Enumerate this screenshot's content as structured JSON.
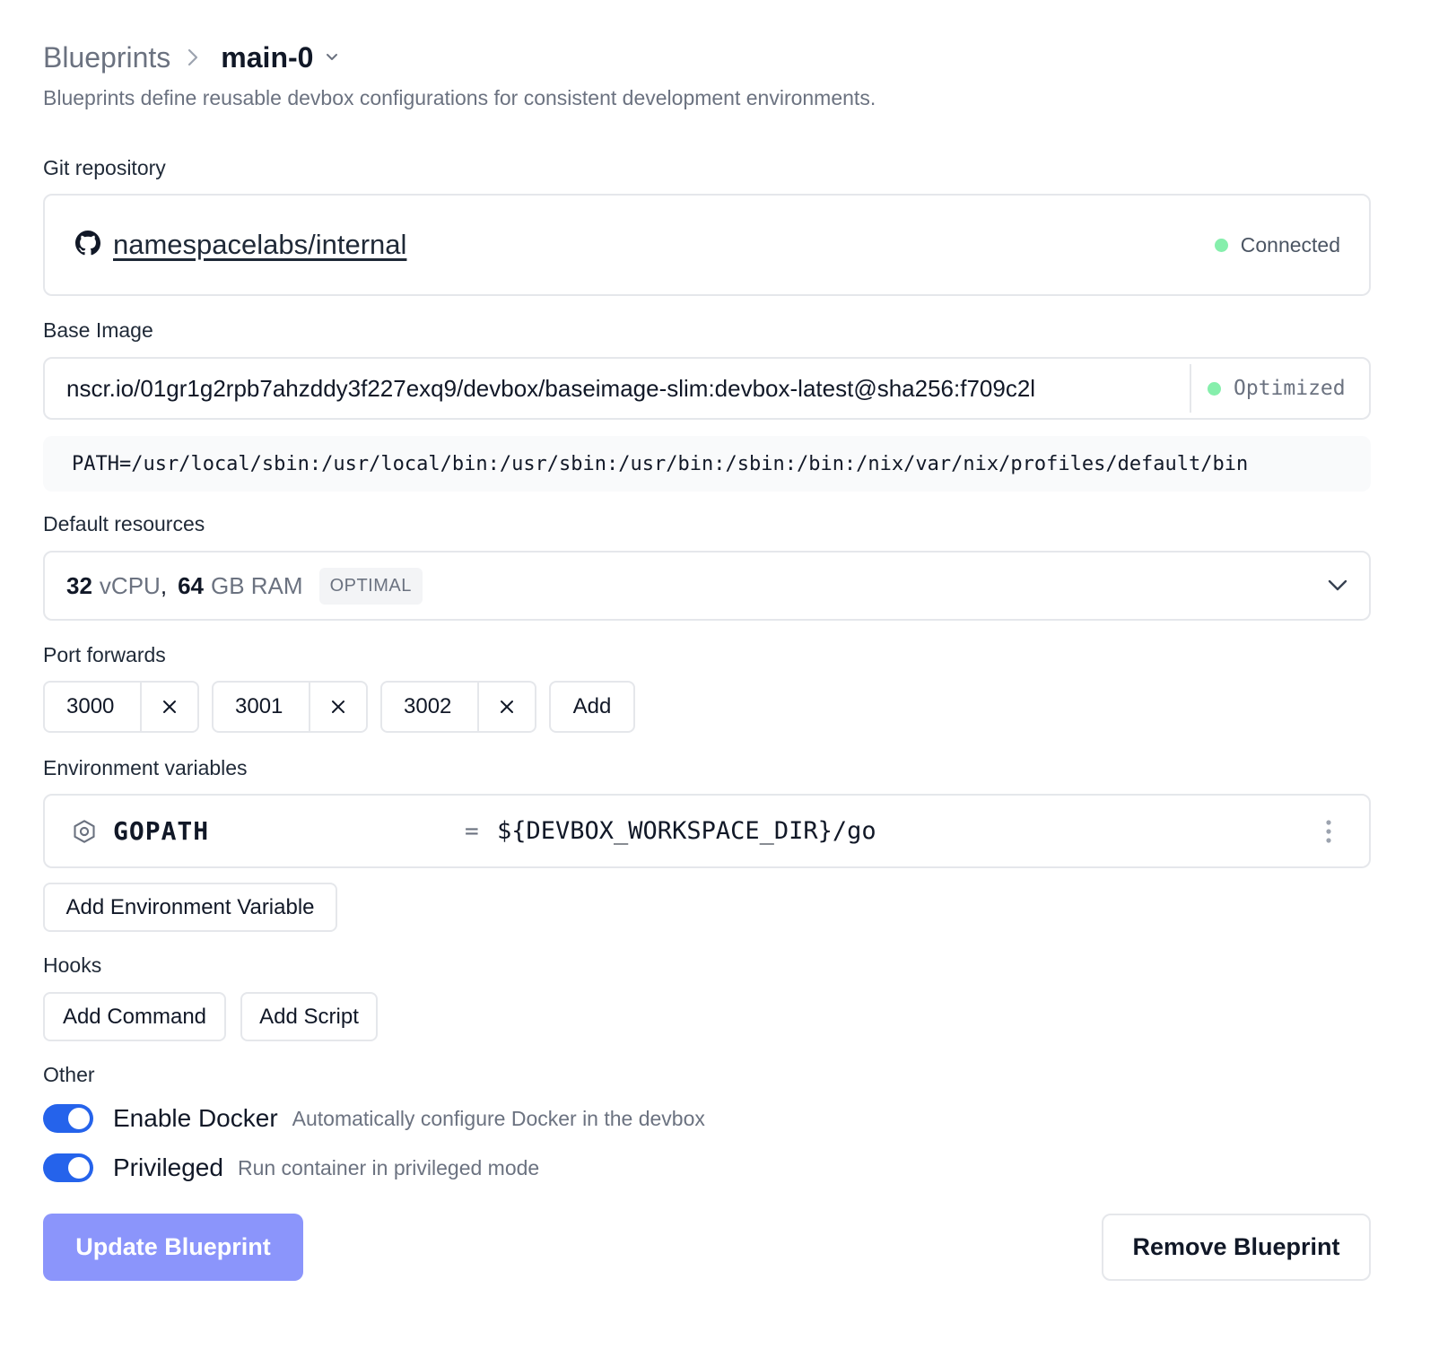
{
  "breadcrumb": {
    "parent": "Blueprints",
    "current": "main-0"
  },
  "description": "Blueprints define reusable devbox configurations for consistent development environments.",
  "git": {
    "label": "Git repository",
    "repo": "namespacelabs/internal",
    "status": "Connected",
    "status_color": "#86efac"
  },
  "base_image": {
    "label": "Base Image",
    "value": "nscr.io/01gr1g2rpb7ahzddy3f227exq9/devbox/baseimage-slim:devbox-latest@sha256:f709c2l",
    "badge": "Optimized",
    "path": "PATH=/usr/local/sbin:/usr/local/bin:/usr/sbin:/usr/bin:/sbin:/bin:/nix/var/nix/profiles/default/bin"
  },
  "resources": {
    "label": "Default resources",
    "cpu_value": "32",
    "cpu_unit": "vCPU",
    "ram_value": "64",
    "ram_unit": "GB RAM",
    "tag": "OPTIMAL"
  },
  "ports": {
    "label": "Port forwards",
    "items": [
      "3000",
      "3001",
      "3002"
    ],
    "add_label": "Add"
  },
  "env": {
    "label": "Environment variables",
    "items": [
      {
        "name": "GOPATH",
        "eq": "=",
        "value": "${DEVBOX_WORKSPACE_DIR}/go"
      }
    ],
    "add_label": "Add Environment Variable"
  },
  "hooks": {
    "label": "Hooks",
    "add_command": "Add Command",
    "add_script": "Add Script"
  },
  "other": {
    "label": "Other",
    "docker": {
      "label": "Enable Docker",
      "desc": "Automatically configure Docker in the devbox",
      "enabled": true
    },
    "privileged": {
      "label": "Privileged",
      "desc": "Run container in privileged mode",
      "enabled": true
    }
  },
  "actions": {
    "update": "Update Blueprint",
    "remove": "Remove Blueprint"
  },
  "colors": {
    "accent": "#2563eb",
    "update_button": "#8b95fb",
    "border": "#e5e7eb",
    "muted_text": "#6b7280"
  }
}
